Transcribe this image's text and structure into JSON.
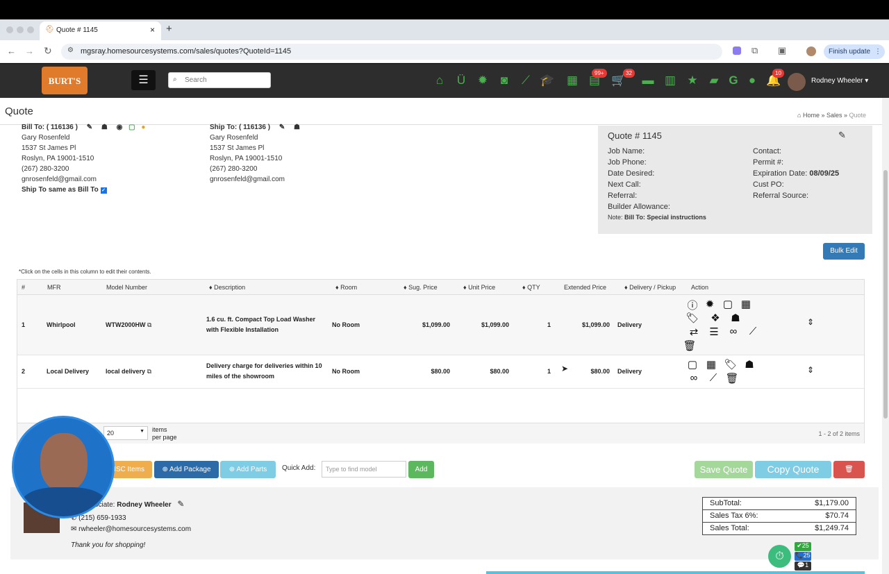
{
  "browser": {
    "tab_title": "Quote # 1145",
    "url": "mgsray.homesourcesystems.com/sales/quotes?QuoteId=1145",
    "finish_update": "Finish update",
    "new_tab": "+",
    "tab_close": "×"
  },
  "app": {
    "logo": "BURT'S",
    "search_placeholder": "Search",
    "badge_99": "99+",
    "badge_32": "32",
    "badge_10": "10",
    "user_name": "Rodney Wheeler ▾"
  },
  "page": {
    "title": "Quote",
    "breadcrumb": [
      "Home",
      "Sales",
      "Quote"
    ]
  },
  "bill_to": {
    "label": "Bill To: ( 116136 )",
    "name": "Gary Rosenfeld",
    "street": "1537 St James Pl",
    "city": "Roslyn, PA 19001-1510",
    "phone": "(267) 280-3200",
    "email": "gnrosenfeld@gmail.com",
    "same_label": "Ship To same as Bill To"
  },
  "ship_to": {
    "label": "Ship To: ( 116136 )",
    "name": "Gary Rosenfeld",
    "street": "1537 St James Pl",
    "city": "Roslyn, PA 19001-1510",
    "phone": "(267) 280-3200",
    "email": "gnrosenfeld@gmail.com"
  },
  "quote": {
    "title": "Quote # 1145",
    "job_name": "Job Name:",
    "job_phone": "Job Phone:",
    "date_desired": "Date Desired:",
    "next_call": "Next Call:",
    "referral": "Referral:",
    "builder_allowance": "Builder Allowance:",
    "note_label": "Note:",
    "note_value": "Bill To: Special instructions",
    "contact": "Contact:",
    "permit": "Permit #:",
    "expiration_label": "Expiration Date:",
    "expiration_value": "08/09/25",
    "cust_po": "Cust PO:",
    "referral_source": "Referral Source:"
  },
  "bulk_edit": "Bulk Edit",
  "grid_note": "*Click on the cells in this column to edit their contents.",
  "columns": [
    "#",
    "MFR",
    "Model Number",
    "♦ Description",
    "♦ Room",
    "♦ Sug. Price",
    "♦ Unit Price",
    "♦ QTY",
    "Extended Price",
    "♦ Delivery / Pickup",
    "Action"
  ],
  "rows": [
    {
      "num": "1",
      "mfr": "Whirlpool",
      "model": "WTW2000HW",
      "description": "1.6 cu. ft. Compact Top Load Washer with Flexible Installation",
      "room": "No Room",
      "sug_price": "$1,099.00",
      "unit_price": "$1,099.00",
      "qty": "1",
      "ext_price": "$1,099.00",
      "delivery": "Delivery"
    },
    {
      "num": "2",
      "mfr": "Local Delivery",
      "model": "local delivery",
      "description": "Delivery charge for deliveries within 10 miles of the showroom",
      "room": "No Room",
      "sug_price": "$80.00",
      "unit_price": "$80.00",
      "qty": "1",
      "ext_price": "$80.00",
      "delivery": "Delivery"
    }
  ],
  "pager": {
    "page_size": "20",
    "items_label": "items",
    "per_page_label": "per page",
    "summary": "1 - 2 of 2 items"
  },
  "actions": {
    "misc_items": "ISC Items",
    "add_package": "Add Package",
    "add_parts": "Add Parts",
    "quick_add_label": "Quick Add:",
    "quick_add_placeholder": "Type to find model",
    "add": "Add",
    "save_quote": "Save Quote",
    "copy_quote": "Copy Quote"
  },
  "associate": {
    "label": "ociate:",
    "name": "Rodney Wheeler",
    "phone": "(215) 659-1933",
    "email": "rwheeler@homesourcesystems.com",
    "thanks": "Thank you for shopping!"
  },
  "totals": {
    "subtotal_label": "SubTotal:",
    "subtotal": "$1,179.00",
    "tax_label": "Sales Tax 6%:",
    "tax": "$70.74",
    "total_label": "Sales Total:",
    "total": "$1,249.74"
  },
  "widget": {
    "green": "✔25",
    "blue": "📞25",
    "dark": "💬1"
  },
  "colors": {
    "accent_green": "#4caf50",
    "bulk_blue": "#337ab7",
    "save_green": "#a4d89a",
    "copy_blue": "#7fcde5",
    "delete_red": "#d9534f",
    "misc_orange": "#f0ad4e"
  }
}
